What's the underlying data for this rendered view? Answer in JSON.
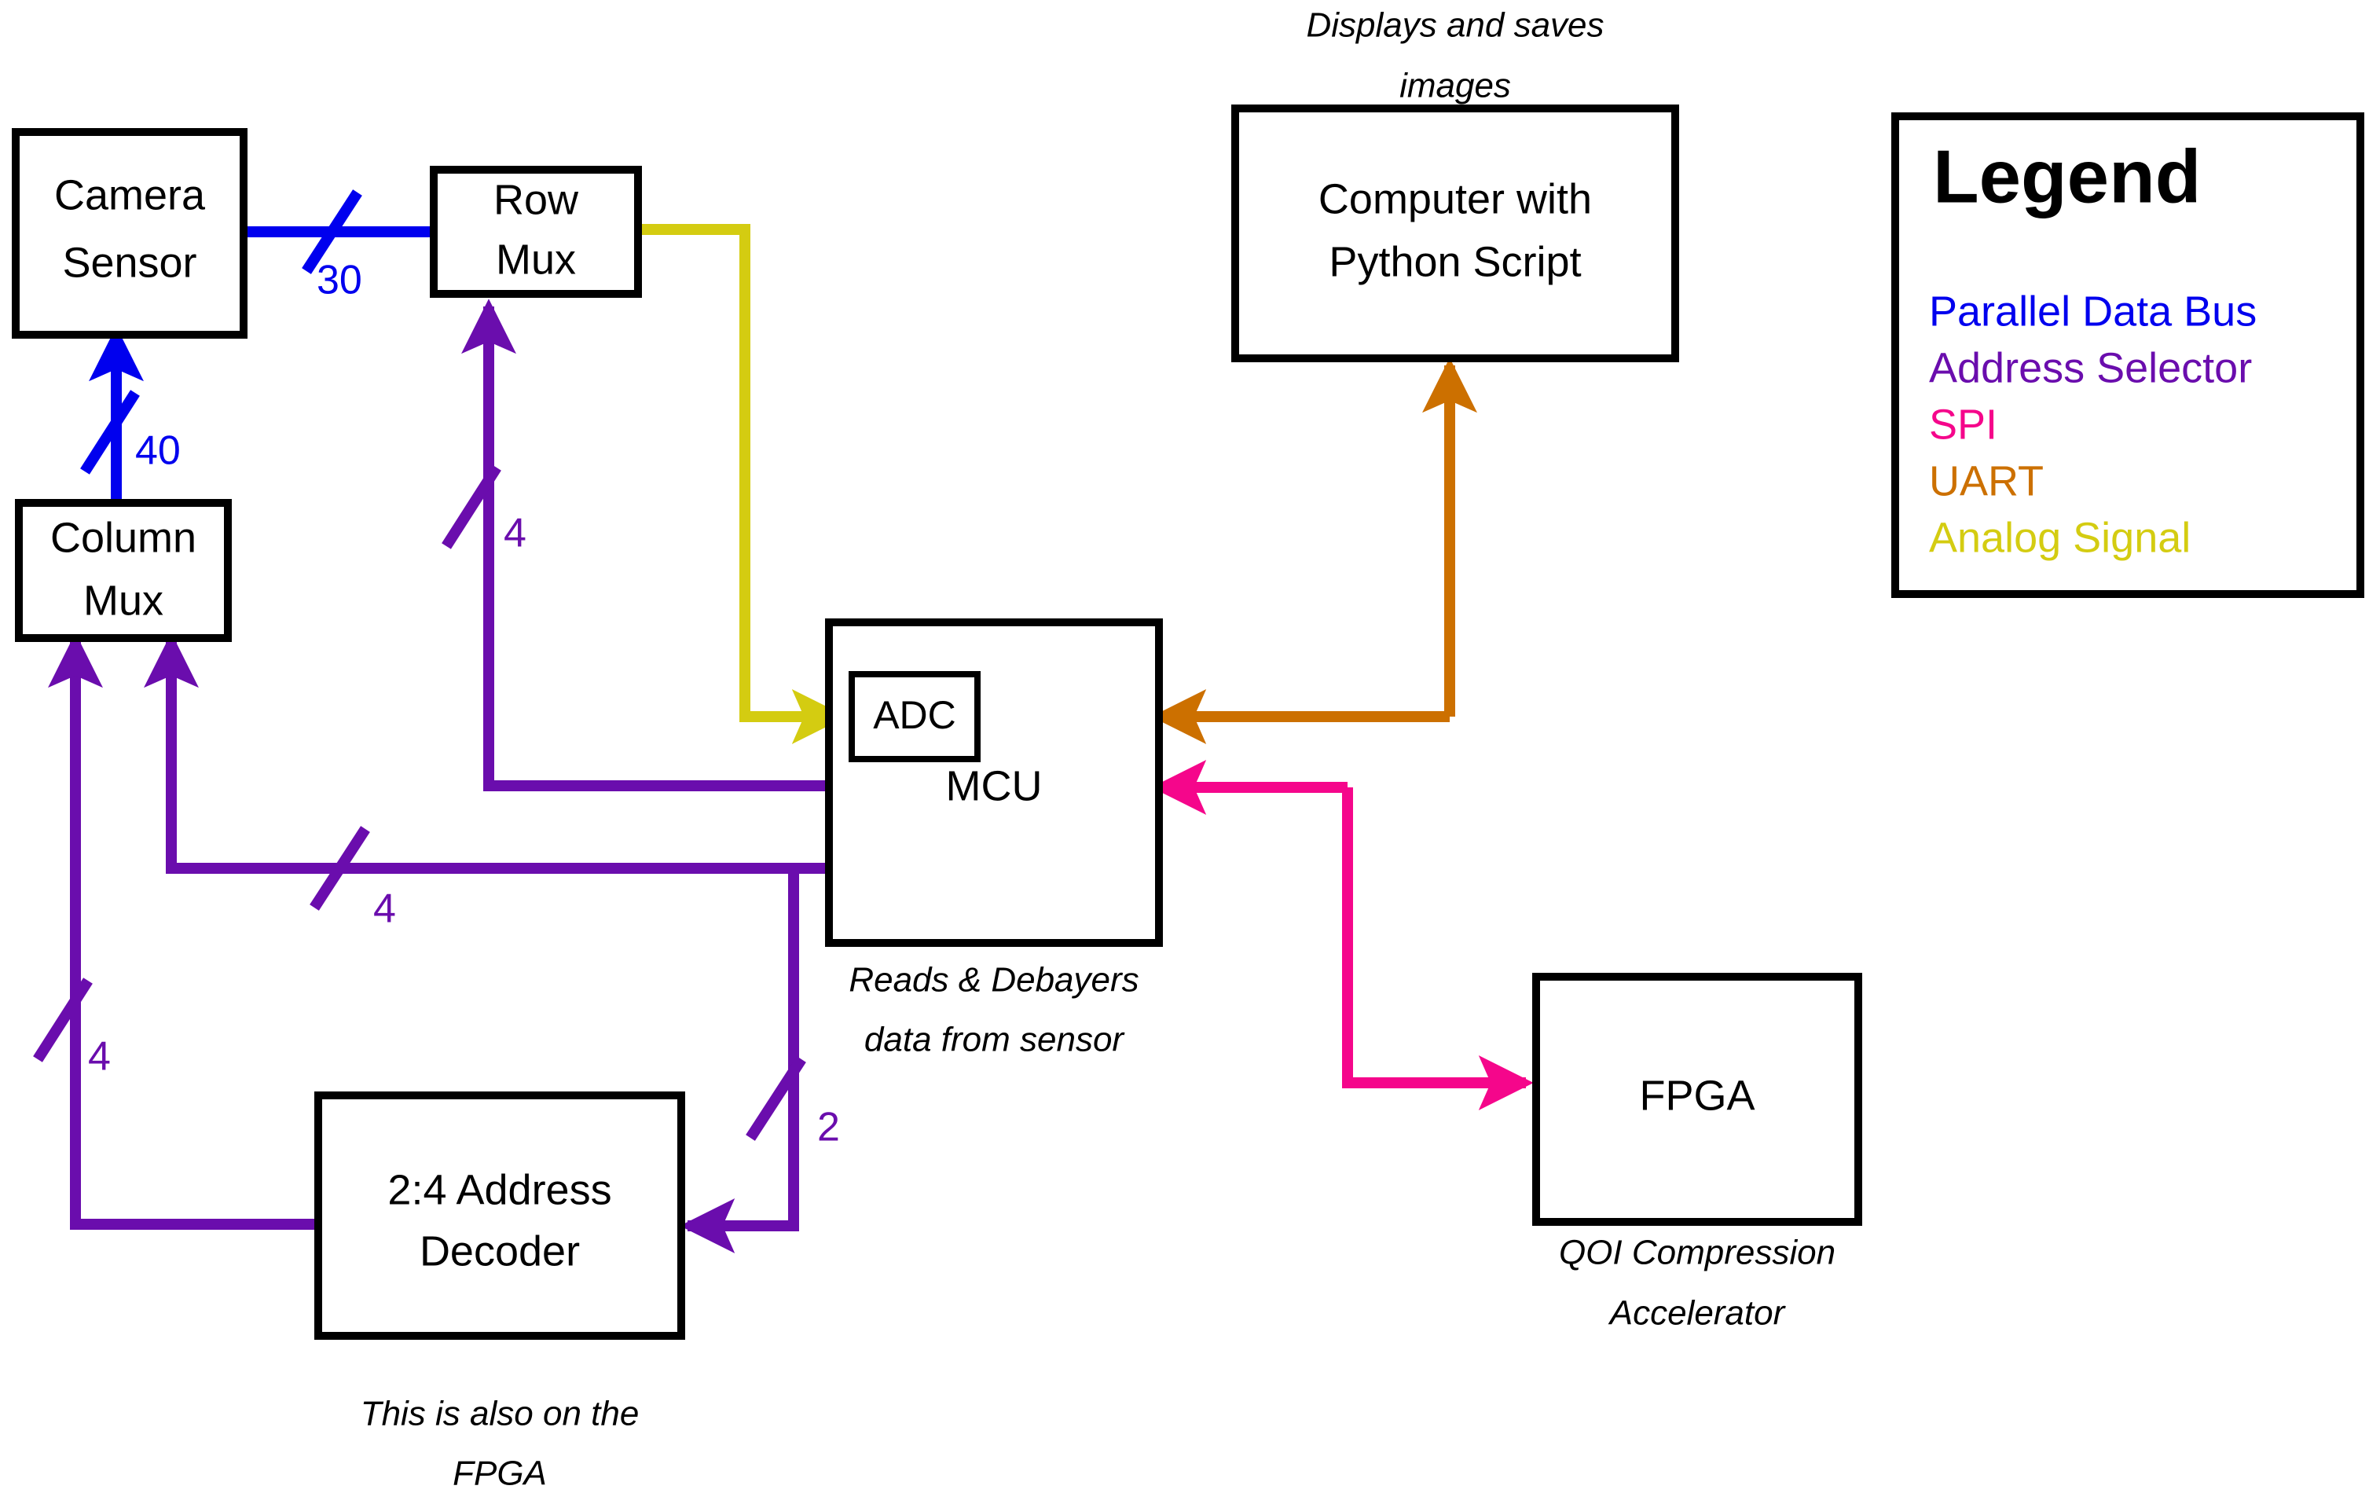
{
  "colors": {
    "parallel_data_bus": "#0000ee",
    "address_selector": "#6a0dad",
    "spi": "#f5068b",
    "uart": "#cc7000",
    "analog_signal": "#d4cc11",
    "outline": "#000000",
    "background": "#ffffff"
  },
  "blocks": {
    "camera_sensor": {
      "line1": "Camera",
      "line2": "Sensor"
    },
    "column_mux": {
      "line1": "Column",
      "line2": "Mux"
    },
    "row_mux": {
      "line1": "Row",
      "line2": "Mux"
    },
    "mcu": {
      "label": "MCU",
      "adc_label": "ADC",
      "caption_line1": "Reads & Debayers",
      "caption_line2": "data from sensor"
    },
    "computer": {
      "line1": "Computer with",
      "line2": "Python Script",
      "caption_line1": "Displays and saves",
      "caption_line2": "images"
    },
    "fpga": {
      "label": "FPGA",
      "caption_line1": "QOI Compression",
      "caption_line2": "Accelerator"
    },
    "address_decoder": {
      "line1": "2:4 Address",
      "line2": "Decoder",
      "caption_line1": "This is also on the",
      "caption_line2": "FPGA"
    }
  },
  "bus_labels": {
    "sensor_to_rowmux": "30",
    "colmux_to_sensor": "40",
    "mcu_to_rowmux": "4",
    "mcu_to_colmux": "4",
    "decoder_to_colmux": "4",
    "mcu_to_decoder": "2"
  },
  "legend": {
    "title": "Legend",
    "entries": [
      {
        "label": "Parallel Data Bus",
        "color": "#0000ee"
      },
      {
        "label": "Address Selector",
        "color": "#6a0dad"
      },
      {
        "label": "SPI",
        "color": "#f5068b"
      },
      {
        "label": "UART",
        "color": "#cc7000"
      },
      {
        "label": "Analog Signal",
        "color": "#d4cc11"
      }
    ]
  }
}
